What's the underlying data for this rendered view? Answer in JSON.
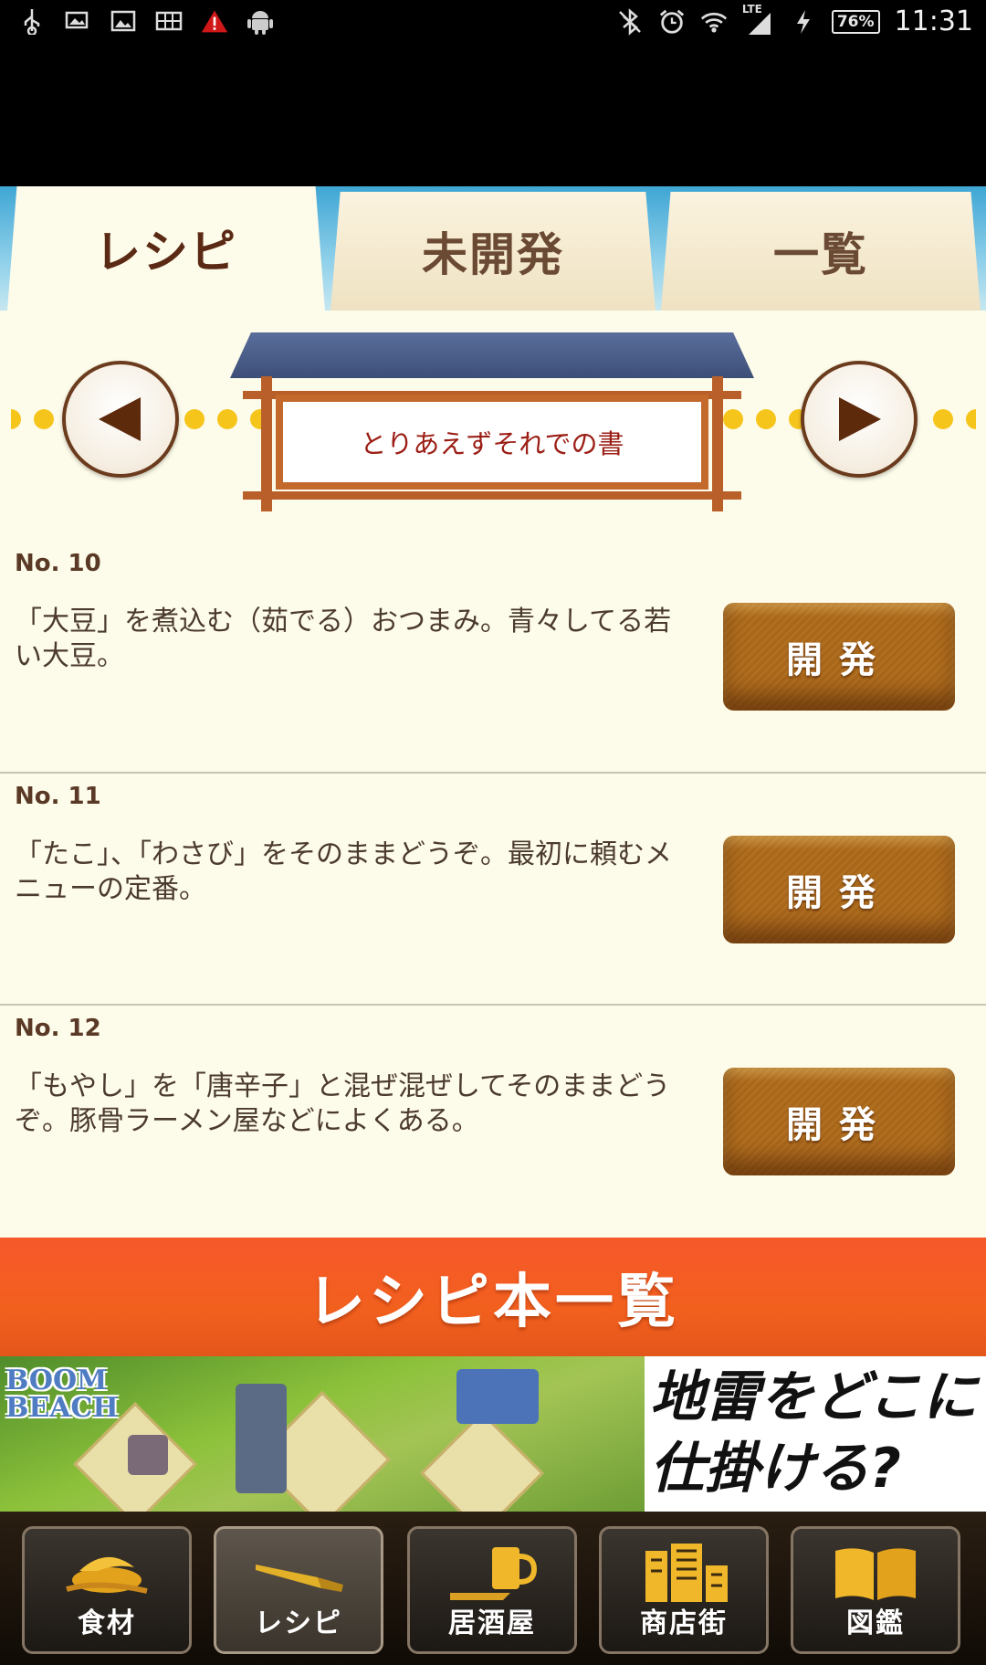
{
  "status_bar": {
    "time": "11:31",
    "battery": "76%",
    "network": "LTE",
    "left_icons": [
      "usb-icon",
      "picture-sync-icon",
      "gallery-icon",
      "grid-icon",
      "warning-icon",
      "android-icon"
    ],
    "right_icons": [
      "bluetooth-off-icon",
      "alarm-icon",
      "wifi-icon",
      "signal-icon",
      "charging-icon"
    ]
  },
  "tabs": [
    {
      "label": "レシピ",
      "active": true
    },
    {
      "label": "未開発",
      "active": false
    },
    {
      "label": "一覧",
      "active": false
    }
  ],
  "book": {
    "title": "とりあえずそれでの書",
    "prev_icon": "arrow-left-icon",
    "next_icon": "arrow-right-icon"
  },
  "recipes": [
    {
      "number": "No. 10",
      "description": "「大豆」を煮込む（茹でる）おつまみ。青々してる若い大豆。",
      "button": "開発"
    },
    {
      "number": "No. 11",
      "description": "「たこ」、「わさび」をそのままどうぞ。最初に頼むメニューの定番。",
      "button": "開発"
    },
    {
      "number": "No. 12",
      "description": "「もやし」を「唐辛子」と混ぜ混ぜしてそのままどうぞ。豚骨ラーメン屋などによくある。",
      "button": "開発"
    }
  ],
  "book_list_button": "レシピ本一覧",
  "ad": {
    "logo_line1": "BOOM",
    "logo_line2": "BEACH",
    "text_line1": "地雷をどこに",
    "text_line2": "仕掛ける?"
  },
  "bottom_nav": [
    {
      "label": "食材",
      "icon": "ingredients-icon",
      "active": false
    },
    {
      "label": "レシピ",
      "icon": "recipe-knife-icon",
      "active": true
    },
    {
      "label": "居酒屋",
      "icon": "izakaya-beer-icon",
      "active": false
    },
    {
      "label": "商店街",
      "icon": "shopping-street-icon",
      "active": false
    },
    {
      "label": "図鑑",
      "icon": "encyclopedia-book-icon",
      "active": false
    }
  ],
  "colors": {
    "accent_orange": "#f2601e",
    "brown_text": "#5a2a14",
    "cream_bg": "#fdfbe9",
    "button_brown": "#a8661a",
    "dot_yellow": "#f6c51c"
  }
}
